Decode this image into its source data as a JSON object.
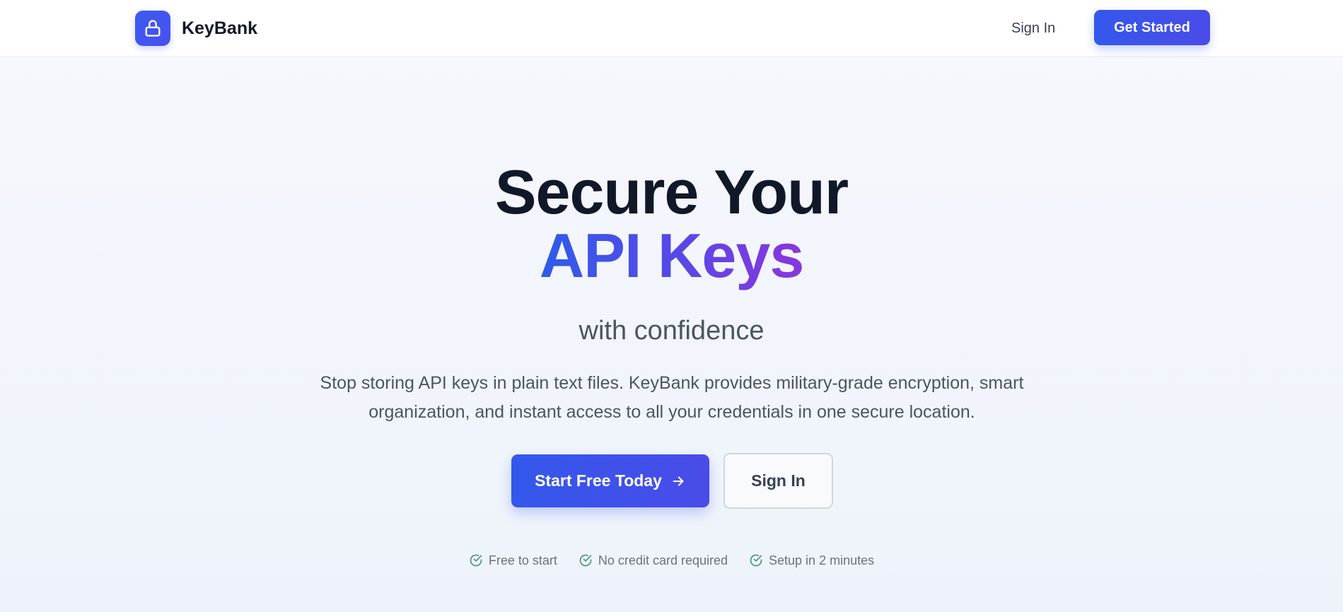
{
  "header": {
    "brand_name": "KeyBank",
    "logo_icon": "lock-icon",
    "nav_signin_label": "Sign In",
    "get_started_label": "Get Started"
  },
  "hero": {
    "title_line1": "Secure Your",
    "title_line2": "API Keys",
    "subtitle": "with confidence",
    "description": "Stop storing API keys in plain text files. KeyBank provides military-grade encryption, smart organization, and instant access to all your credentials in one secure location.",
    "primary_cta_label": "Start Free Today",
    "primary_cta_icon": "arrow-right-icon",
    "secondary_cta_label": "Sign In"
  },
  "features": [
    {
      "label": "Free to start",
      "icon": "check-circle-icon"
    },
    {
      "label": "No credit card required",
      "icon": "check-circle-icon"
    },
    {
      "label": "Setup in 2 minutes",
      "icon": "check-circle-icon"
    }
  ],
  "colors": {
    "accent": "#3b5bf0",
    "gradient_end": "#8a36dd",
    "check": "#4f8f7a"
  }
}
